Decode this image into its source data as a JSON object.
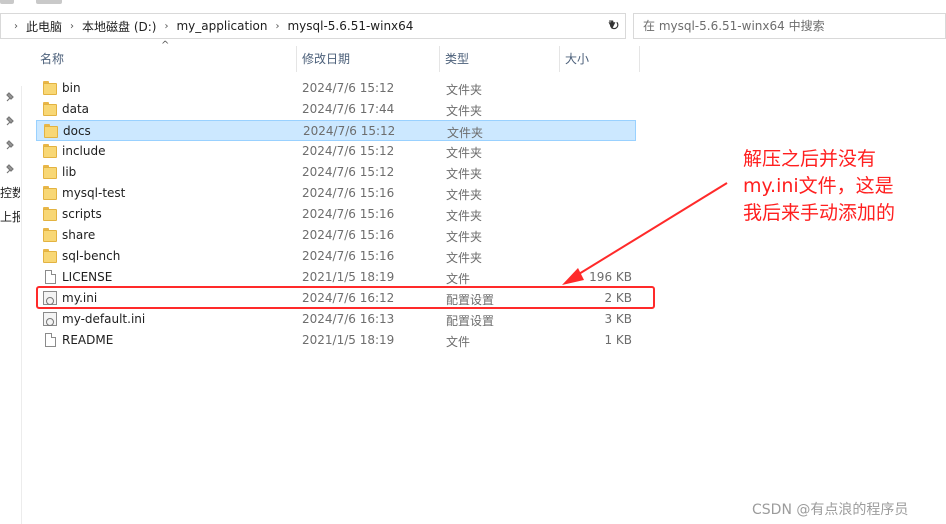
{
  "address": {
    "crumbs": [
      "此电脑",
      "本地磁盘 (D:)",
      "my_application",
      "mysql-5.6.51-winx64"
    ]
  },
  "search": {
    "placeholder": "在 mysql-5.6.51-winx64 中搜索"
  },
  "columns": {
    "name": "名称",
    "date": "修改日期",
    "type": "类型",
    "size": "大小"
  },
  "left_nav": {
    "frag1": "控数",
    "frag2": "上报"
  },
  "files": [
    {
      "name": "bin",
      "date": "2024/7/6 15:12",
      "type": "文件夹",
      "size": "",
      "icon": "folder-icon"
    },
    {
      "name": "data",
      "date": "2024/7/6 17:44",
      "type": "文件夹",
      "size": "",
      "icon": "folder-icon"
    },
    {
      "name": "docs",
      "date": "2024/7/6 15:12",
      "type": "文件夹",
      "size": "",
      "icon": "folder-icon",
      "selected": true
    },
    {
      "name": "include",
      "date": "2024/7/6 15:12",
      "type": "文件夹",
      "size": "",
      "icon": "folder-icon"
    },
    {
      "name": "lib",
      "date": "2024/7/6 15:12",
      "type": "文件夹",
      "size": "",
      "icon": "folder-icon"
    },
    {
      "name": "mysql-test",
      "date": "2024/7/6 15:16",
      "type": "文件夹",
      "size": "",
      "icon": "folder-icon"
    },
    {
      "name": "scripts",
      "date": "2024/7/6 15:16",
      "type": "文件夹",
      "size": "",
      "icon": "folder-icon"
    },
    {
      "name": "share",
      "date": "2024/7/6 15:16",
      "type": "文件夹",
      "size": "",
      "icon": "folder-icon"
    },
    {
      "name": "sql-bench",
      "date": "2024/7/6 15:16",
      "type": "文件夹",
      "size": "",
      "icon": "folder-icon"
    },
    {
      "name": "LICENSE",
      "date": "2021/1/5 18:19",
      "type": "文件",
      "size": "196 KB",
      "icon": "document-icon"
    },
    {
      "name": "my.ini",
      "date": "2024/7/6 16:12",
      "type": "配置设置",
      "size": "2 KB",
      "icon": "ini-settings-icon"
    },
    {
      "name": "my-default.ini",
      "date": "2024/7/6 16:13",
      "type": "配置设置",
      "size": "3 KB",
      "icon": "ini-settings-icon"
    },
    {
      "name": "README",
      "date": "2021/1/5 18:19",
      "type": "文件",
      "size": "1 KB",
      "icon": "document-icon"
    }
  ],
  "annotation": {
    "lines": [
      "解压之后并没有",
      "my.ini文件，这是",
      "我后来手动添加的"
    ],
    "color": "#ff1f1f"
  },
  "selection_color": "#cce8ff",
  "watermark": "CSDN @有点浪的程序员"
}
